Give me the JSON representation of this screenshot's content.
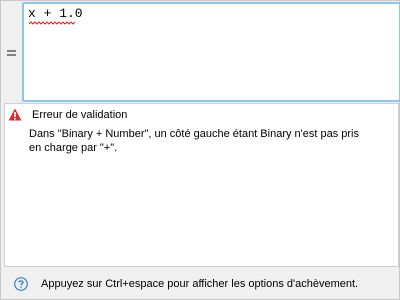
{
  "editor": {
    "expression": "x + 1.0",
    "side_icon": "equals-icon"
  },
  "validation": {
    "icon": "error-triangle-icon",
    "title": "Erreur de validation",
    "message": "Dans \"Binary + Number\", un côté gauche étant Binary n'est pas pris en charge par \"+\"."
  },
  "footer": {
    "icon": "hint-icon",
    "hint": "Appuyez sur Ctrl+espace pour afficher les options d'achèvement."
  },
  "colors": {
    "editor_focus_border": "#8ec6e9",
    "error_red": "#d32f2f",
    "squiggle_red": "#e02020",
    "hint_blue": "#4a7fb0"
  }
}
